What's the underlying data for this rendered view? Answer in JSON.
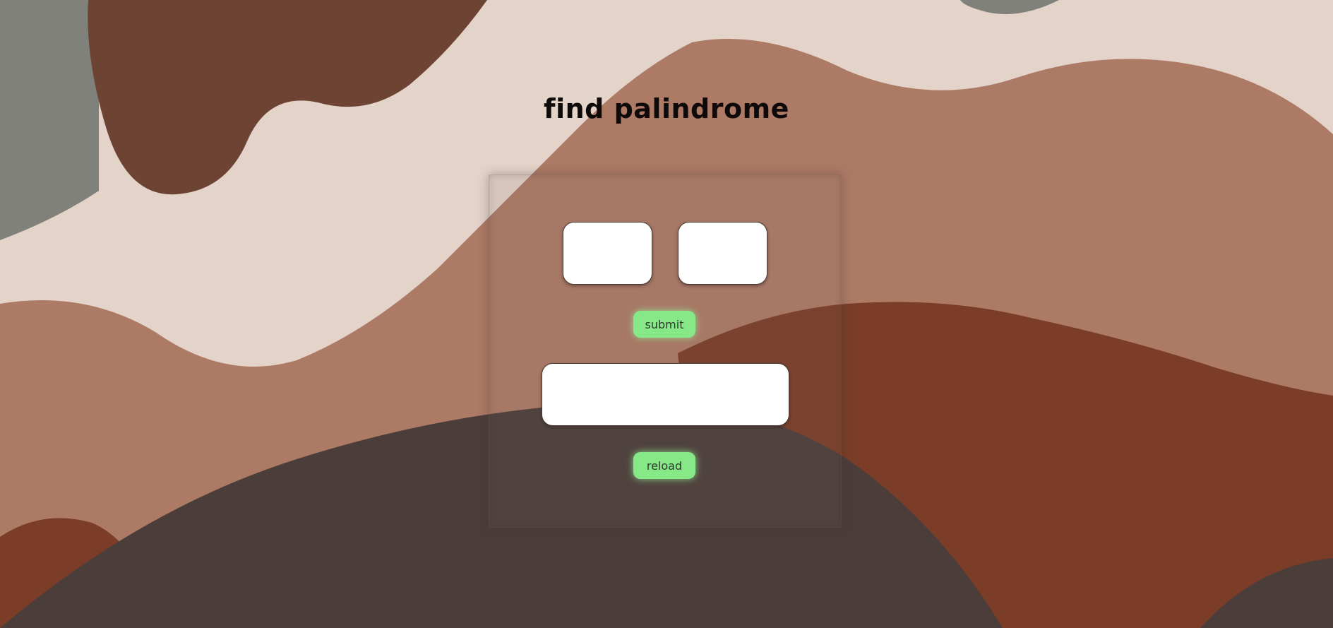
{
  "page": {
    "title": "find palindrome"
  },
  "inputs": {
    "first_value": "",
    "second_value": "",
    "result_value": ""
  },
  "buttons": {
    "submit_label": "submit",
    "reload_label": "reload"
  },
  "colors": {
    "button_green": "#86e886",
    "terracotta": "#b07b68",
    "dark_brown": "#6e4536",
    "rust": "#7e3c26",
    "charcoal": "#4a3d39",
    "grey_green": "#7d7f78",
    "cream": "#e6d8cf"
  }
}
